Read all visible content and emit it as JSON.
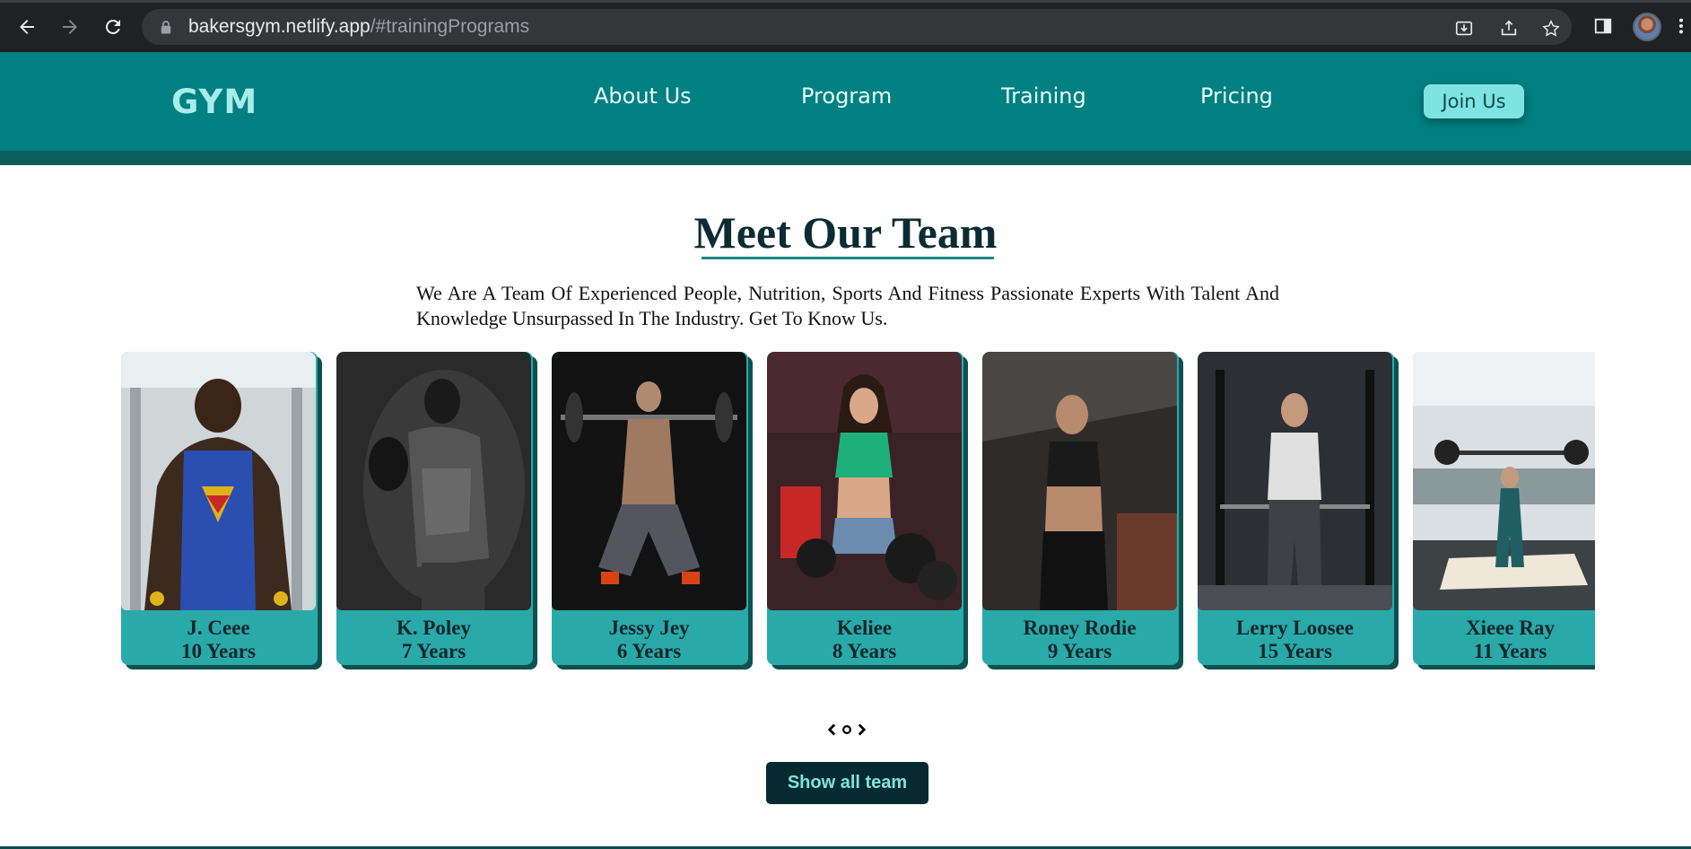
{
  "browser": {
    "url_host": "bakersgym.netlify.app",
    "url_path": "/#trainingPrograms",
    "icons": [
      "back-arrow-icon",
      "forward-arrow-icon",
      "reload-icon",
      "lock-icon",
      "install-icon",
      "share-icon",
      "bookmark-star-icon",
      "side-panel-icon",
      "profile-avatar",
      "menu-icon"
    ]
  },
  "header": {
    "logo": "GYM",
    "nav": [
      "About Us",
      "Program",
      "Training",
      "Pricing"
    ],
    "join_label": "Join Us",
    "colors": {
      "header_bg": "#008080",
      "accent": "#7fe3e3"
    }
  },
  "team": {
    "title": "Meet Our Team",
    "intro": "We Are A Team Of Experienced People, Nutrition, Sports And Fitness Passionate Experts With Talent And Knowledge Unsurpassed In The Industry. Get To Know Us.",
    "members": [
      {
        "name": "J. Ceee",
        "years": "10 Years"
      },
      {
        "name": "K. Poley",
        "years": "7 Years"
      },
      {
        "name": "Jessy Jey",
        "years": "6 Years"
      },
      {
        "name": "Keliee",
        "years": "8 Years"
      },
      {
        "name": "Roney Rodie",
        "years": "9 Years"
      },
      {
        "name": "Lerry Loosee",
        "years": "15 Years"
      },
      {
        "name": "Xieee Ray",
        "years": "11 Years"
      }
    ],
    "show_all_label": "Show all team",
    "colors": {
      "card_bg": "#2aa9a9",
      "button_bg": "#062a2f"
    }
  }
}
